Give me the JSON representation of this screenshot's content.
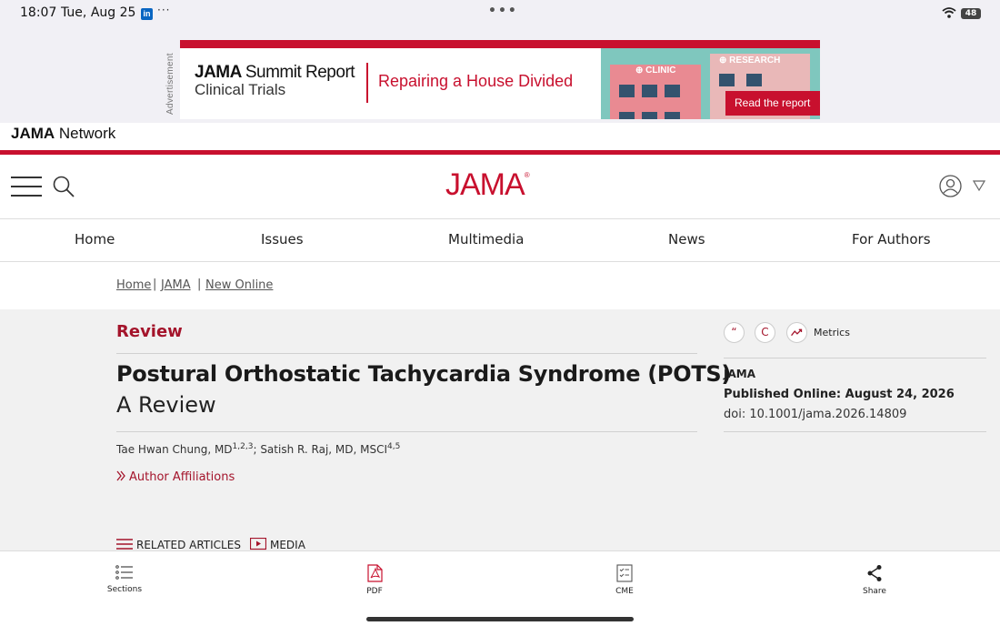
{
  "status_bar": {
    "time": "18:07",
    "date": "Tue, Aug 25",
    "app_badge": "in",
    "more": "···",
    "battery": "48"
  },
  "ad": {
    "label": "Advertisement",
    "brand": "JAMA Summit Report",
    "brand_a": "JAMA",
    "brand_b": "Summit Report",
    "subtitle": "Clinical Trials",
    "headline": "Repairing a House Divided",
    "sign_left": "CLINIC",
    "sign_right": "RESEARCH",
    "cta": "Read the report"
  },
  "network": {
    "bold": "JAMA",
    "rest": " Network"
  },
  "header": {
    "logo": "JAMA",
    "logo_mark": "®"
  },
  "nav": {
    "items": [
      "Home",
      "Issues",
      "Multimedia",
      "News",
      "For Authors"
    ]
  },
  "breadcrumb": [
    "Home",
    "JAMA",
    "New Online"
  ],
  "article": {
    "type": "Review",
    "title": "Postural Orthostatic Tachycardia Syndrome (POTS)",
    "subtitle": "A Review",
    "author1": "Tae Hwan Chung, MD",
    "author1_sup": "1,2,3",
    "author_sep": "; ",
    "author2": "Satish R. Raj, MD, MSCI",
    "author2_sup": "4,5",
    "affiliations": "Author Affiliations",
    "related": "RELATED ARTICLES",
    "media": "MEDIA"
  },
  "sidebar": {
    "cite_glyph": "“",
    "permissions_glyph": "C",
    "metrics": "Metrics",
    "journal": "JAMA",
    "published": "Published Online: August 24, 2026",
    "doi": "doi: 10.1001/jama.2026.14809"
  },
  "toolbar": {
    "sections": "Sections",
    "pdf": "PDF",
    "cme": "CME",
    "share": "Share"
  },
  "colors": {
    "brand": "#c8102e",
    "accent_text": "#a4142b"
  }
}
